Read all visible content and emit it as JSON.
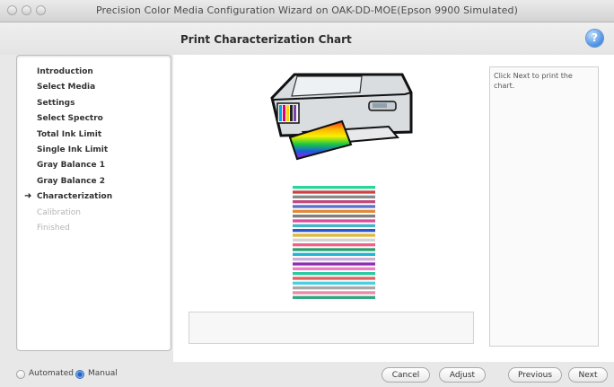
{
  "window": {
    "title": "Precision Color Media Configuration Wizard on OAK-DD-MOE(Epson 9900 Simulated)"
  },
  "header": {
    "page_title": "Print Characterization Chart",
    "help_label": "?"
  },
  "steps": [
    {
      "label": "Introduction",
      "state": "done"
    },
    {
      "label": "Select Media",
      "state": "done"
    },
    {
      "label": "Settings",
      "state": "done"
    },
    {
      "label": "Select Spectro",
      "state": "done"
    },
    {
      "label": "Total Ink Limit",
      "state": "done"
    },
    {
      "label": "Single Ink Limit",
      "state": "done"
    },
    {
      "label": "Gray Balance 1",
      "state": "done"
    },
    {
      "label": "Gray Balance 2",
      "state": "done"
    },
    {
      "label": "Characterization",
      "state": "current"
    },
    {
      "label": "Calibration",
      "state": "disabled"
    },
    {
      "label": "Finished",
      "state": "disabled"
    }
  ],
  "current_step_marker": "➜",
  "main": {
    "instruction": "Click Next to print the chart.",
    "message": ""
  },
  "footer": {
    "mode_options": [
      {
        "label": "Automated",
        "selected": false
      },
      {
        "label": "Manual",
        "selected": true
      }
    ],
    "buttons": {
      "cancel": "Cancel",
      "adjust": "Adjust",
      "previous": "Previous",
      "next": "Next"
    }
  },
  "colors": {
    "accent": "#4a8ee0",
    "chart_stripes": [
      "#2bd49a",
      "#c84545",
      "#8a8a8a",
      "#c04b7a",
      "#5b6fc8",
      "#e08a3a",
      "#7f7f7f",
      "#d94f9a",
      "#40b6c9",
      "#2c56c7",
      "#e2b63a",
      "#d4d4d4",
      "#f2608a",
      "#2a9e6b",
      "#1fb5d2",
      "#c9b0d8",
      "#8c2fb0",
      "#f07cc8",
      "#2acaa0",
      "#e06060",
      "#4ccfe0",
      "#a8a8a8",
      "#e88aa8",
      "#30a880"
    ]
  }
}
